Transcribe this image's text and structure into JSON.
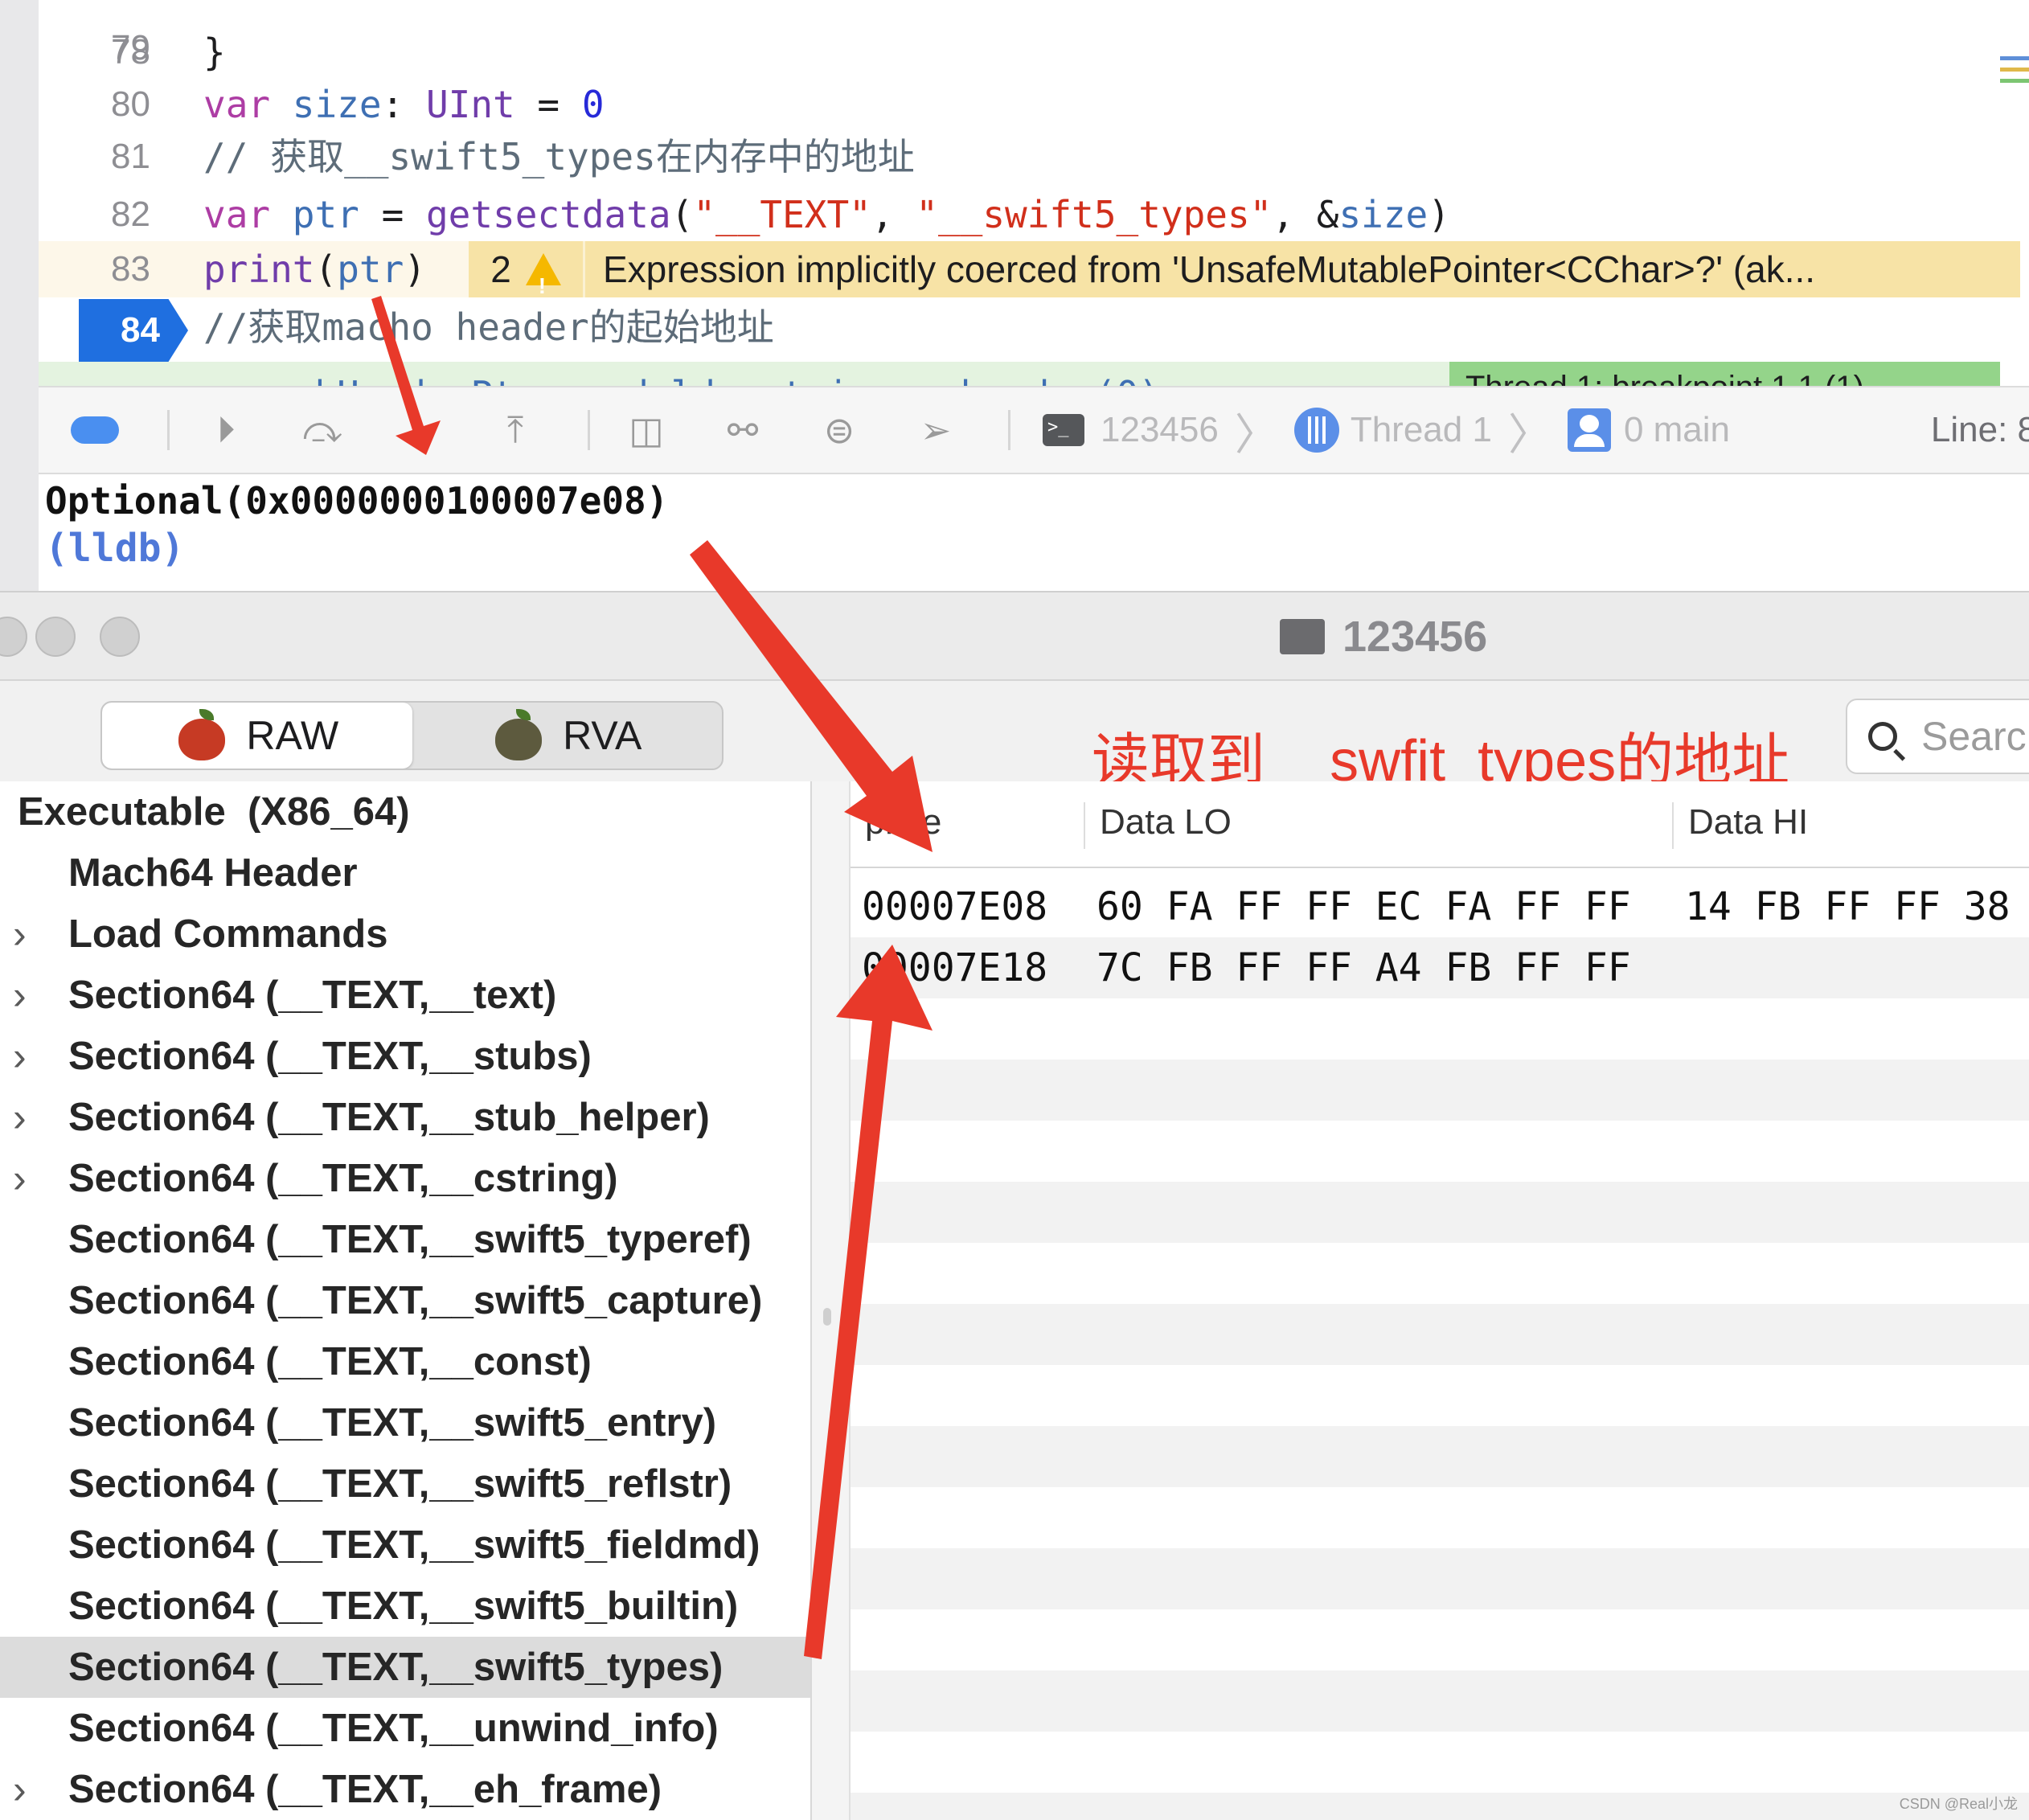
{
  "editor": {
    "lines": [
      {
        "no": "79"
      },
      {
        "no": "80",
        "tokens": [
          [
            "kw",
            "var "
          ],
          [
            "ident",
            "size"
          ],
          [
            "plain",
            ": "
          ],
          [
            "type",
            "UInt"
          ],
          [
            "plain",
            " = "
          ],
          [
            "num",
            "0"
          ]
        ]
      },
      {
        "no": "81",
        "tokens": [
          [
            "cmt",
            "// 获取__swift5_types在内存中的地址"
          ]
        ]
      },
      {
        "no": "82",
        "tokens": [
          [
            "kw",
            "var "
          ],
          [
            "ident",
            "ptr"
          ],
          [
            "plain",
            " = "
          ],
          [
            "type",
            "getsectdata"
          ],
          [
            "plain",
            "("
          ],
          [
            "str",
            "\"__TEXT\""
          ],
          [
            "plain",
            ", "
          ],
          [
            "str",
            "\"__swift5_types\""
          ],
          [
            "plain",
            ", &"
          ],
          [
            "ident",
            "size"
          ],
          [
            "plain",
            ")"
          ]
        ]
      },
      {
        "no": "83",
        "tokens": [
          [
            "type",
            "print"
          ],
          [
            "plain",
            "("
          ],
          [
            "ident",
            "ptr"
          ],
          [
            "plain",
            ")"
          ]
        ]
      },
      {
        "no": "84",
        "tokens": [
          [
            "cmt",
            "//获取macho header的起始地址"
          ]
        ]
      }
    ],
    "warning": {
      "count": "2",
      "message": "Expression implicitly coerced from 'UnsafeMutablePointer<CChar>?' (ak..."
    },
    "breakpoint_line": "84"
  },
  "debug_bar": {
    "process": "123456",
    "thread": "Thread 1",
    "frame": "0 main",
    "line_label": "Line: 8"
  },
  "console": {
    "output": "Optional(0x0000000100007e08)",
    "prompt": "(lldb)"
  },
  "machoview": {
    "window_title": "123456",
    "modes": [
      "RAW",
      "RVA"
    ],
    "active_mode": "RAW",
    "search_placeholder": "Searc",
    "annotation": "读取到__swfit_types的地址",
    "tree": [
      {
        "label": "Executable  (X86_64)",
        "level": 0,
        "expandable": false
      },
      {
        "label": "Mach64 Header",
        "level": 1,
        "expandable": false
      },
      {
        "label": "Load Commands",
        "level": 1,
        "expandable": true
      },
      {
        "label": "Section64 (__TEXT,__text)",
        "level": 1,
        "expandable": true
      },
      {
        "label": "Section64 (__TEXT,__stubs)",
        "level": 1,
        "expandable": true
      },
      {
        "label": "Section64 (__TEXT,__stub_helper)",
        "level": 1,
        "expandable": true
      },
      {
        "label": "Section64 (__TEXT,__cstring)",
        "level": 1,
        "expandable": true
      },
      {
        "label": "Section64 (__TEXT,__swift5_typeref)",
        "level": 1,
        "expandable": false
      },
      {
        "label": "Section64 (__TEXT,__swift5_capture)",
        "level": 1,
        "expandable": false
      },
      {
        "label": "Section64 (__TEXT,__const)",
        "level": 1,
        "expandable": false
      },
      {
        "label": "Section64 (__TEXT,__swift5_entry)",
        "level": 1,
        "expandable": false
      },
      {
        "label": "Section64 (__TEXT,__swift5_reflstr)",
        "level": 1,
        "expandable": false
      },
      {
        "label": "Section64 (__TEXT,__swift5_fieldmd)",
        "level": 1,
        "expandable": false
      },
      {
        "label": "Section64 (__TEXT,__swift5_builtin)",
        "level": 1,
        "expandable": false
      },
      {
        "label": "Section64 (__TEXT,__swift5_types)",
        "level": 1,
        "expandable": false,
        "selected": true
      },
      {
        "label": "Section64 (__TEXT,__unwind_info)",
        "level": 1,
        "expandable": false
      },
      {
        "label": "Section64 (__TEXT,__eh_frame)",
        "level": 1,
        "expandable": true
      }
    ],
    "table": {
      "columns": [
        "pFile",
        "Data LO",
        "Data HI"
      ],
      "rows": [
        {
          "pfile": "00007E08",
          "lo": "60 FA FF FF EC FA FF FF",
          "hi": "14 FB FF FF 38"
        },
        {
          "pfile": "00007E18",
          "lo": "7C FB FF FF A4 FB FF FF",
          "hi": ""
        }
      ]
    },
    "watermark": "CSDN @Real小龙"
  },
  "colors": {
    "arrow": "#e8392a",
    "breakpoint": "#1f6fe0",
    "warning_bg": "#f7e3a6"
  }
}
